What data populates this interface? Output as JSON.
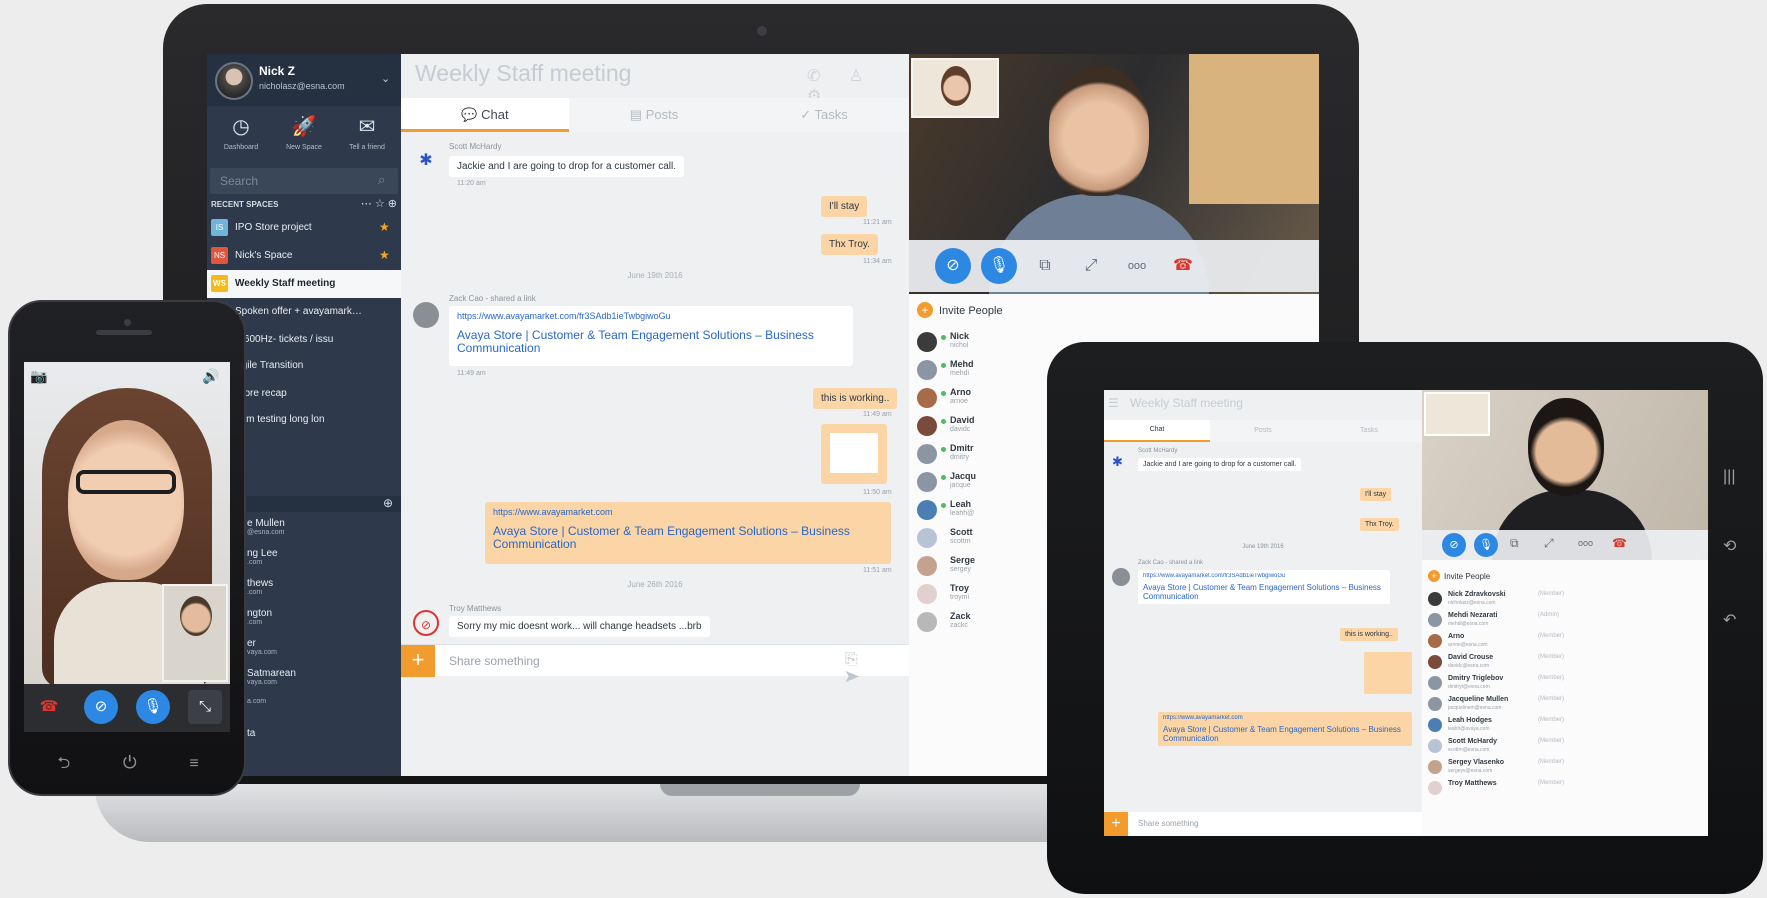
{
  "laptop": {
    "user": {
      "name": "Nick Z",
      "email": "nicholasz@esna.com"
    },
    "quick_actions": [
      {
        "icon": "dashboard-icon",
        "glyph": "◷",
        "label": "Dashboard"
      },
      {
        "icon": "rocket-icon",
        "glyph": "🚀",
        "label": "New Space"
      },
      {
        "icon": "mail-icon",
        "glyph": "✉",
        "label": "Tell a friend"
      }
    ],
    "search": {
      "placeholder": "Search"
    },
    "recent_header": "RECENT SPACES",
    "recent_icons": "⋯ ☆ ⊕",
    "spaces": [
      {
        "badge": "IS",
        "badge_color": "#6fb5d9",
        "name": "IPO Store project",
        "starred": true
      },
      {
        "badge": "NS",
        "badge_color": "#e2553d",
        "name": "Nick's Space",
        "starred": true
      },
      {
        "badge": "WS",
        "badge_color": "#f3b91e",
        "name": "Weekly Staff meeting",
        "starred": false,
        "active": true
      },
      {
        "badge": "SO",
        "badge_color": "#47a6c4",
        "name": "Spoken offer + avayamarket.c",
        "starred": false
      },
      {
        "badge": "",
        "badge_color": "#2e3a4b",
        "name": "-2600Hz- tickets / issu",
        "starred": false
      },
      {
        "badge": "",
        "badge_color": "#2e3a4b",
        "name": "Agile Transition",
        "starred": false
      },
      {
        "badge": "",
        "badge_color": "#2e3a4b",
        "name": "Store recap",
        "starred": false
      },
      {
        "badge": "",
        "badge_color": "#2e3a4b",
        "name": "oom testing long lon",
        "starred": false
      }
    ],
    "people": [
      {
        "name": "e Mullen",
        "sub": "@esna.com"
      },
      {
        "name": "ng Lee",
        "sub": ".com"
      },
      {
        "name": "thews",
        "sub": ".com"
      },
      {
        "name": "ngton",
        "sub": ".com"
      },
      {
        "name": "er",
        "sub": "vaya.com"
      },
      {
        "name": "Satmarean",
        "sub": "vaya.com"
      },
      {
        "name": "",
        "sub": "a.com"
      },
      {
        "name": "ta",
        "sub": ""
      }
    ],
    "chat": {
      "title": "Weekly Staff meeting",
      "header_icons": "✆ ♙ ⚙",
      "tabs": [
        {
          "icon": "chat-icon",
          "glyph": "💬",
          "label": "Chat",
          "active": true
        },
        {
          "icon": "posts-icon",
          "glyph": "▤",
          "label": "Posts",
          "active": false
        },
        {
          "icon": "tasks-icon",
          "glyph": "✓",
          "label": "Tasks",
          "active": false
        }
      ],
      "msg1": {
        "sender": "Scott McHardy",
        "text": "Jackie and I are going to drop for a customer call.",
        "time": "11:20 am"
      },
      "out1": {
        "text": "I'll stay",
        "time": "11:21 am"
      },
      "out2": {
        "text": "Thx Troy.",
        "time": "11:34 am"
      },
      "date1": "June 19th 2016",
      "msg2": {
        "sender": "Zack Cao - shared a link",
        "url": "https://www.avayamarket.com/fr3SAdb1ieTwbgiwoGu",
        "link_title": "Avaya Store | Customer & Team Engagement Solutions – Business Communication",
        "time": "11:49 am"
      },
      "out3": {
        "text": "this is working..",
        "time": "11:49 am"
      },
      "out4_time": "11:50 am",
      "out5": {
        "url": "https://www.avayamarket.com",
        "link_title": "Avaya Store | Customer & Team Engagement Solutions – Business Communication",
        "time": "11:51 am"
      },
      "date2": "June 26th 2016",
      "msg3": {
        "sender": "Troy Matthews",
        "text": "Sorry my mic doesnt work... will change headsets ...brb"
      },
      "compose_placeholder": "Share something",
      "compose_icons": "⎘ ➤"
    },
    "invite_label": "Invite People",
    "participants": [
      {
        "name": "Nick",
        "sub": "nichol"
      },
      {
        "name": "Mehd",
        "sub": "mehdi"
      },
      {
        "name": "Arno",
        "sub": "arnoe"
      },
      {
        "name": "David",
        "sub": "davidc"
      },
      {
        "name": "Dmitr",
        "sub": "dmitry"
      },
      {
        "name": "Jacqu",
        "sub": "jacque"
      },
      {
        "name": "Leah",
        "sub": "leahh@"
      },
      {
        "name": "Scott",
        "sub": "scottm"
      },
      {
        "name": "Serge",
        "sub": "sergey"
      },
      {
        "name": "Troy",
        "sub": "troymi"
      },
      {
        "name": "Zack",
        "sub": "zackc"
      }
    ],
    "call_controls": [
      {
        "name": "video-off-button",
        "glyph": "⊘",
        "style": "blue"
      },
      {
        "name": "mute-button",
        "glyph": "🎙",
        "style": "blue"
      },
      {
        "name": "screen-share-button",
        "glyph": "⧉",
        "style": "plain"
      },
      {
        "name": "expand-button",
        "glyph": "⤢",
        "style": "plain"
      },
      {
        "name": "more-button",
        "glyph": "ooo",
        "style": "plain"
      },
      {
        "name": "hangup-button",
        "glyph": "☎",
        "style": "red"
      }
    ]
  },
  "phone": {
    "top_left_icon": "📷",
    "top_right_icon": "🔊",
    "controls": [
      {
        "name": "phone-hangup-button",
        "glyph": "☎",
        "bg": "#2b2d31",
        "color": "#e0352b"
      },
      {
        "name": "phone-video-button",
        "glyph": "⊘",
        "bg": "#2c88e3",
        "color": "#ffffff"
      },
      {
        "name": "phone-mute-button",
        "glyph": "🎙",
        "bg": "#2c88e3",
        "color": "#ffffff"
      },
      {
        "name": "phone-minimize-button",
        "glyph": "⤡",
        "bg": "#3c3f45",
        "color": "#ffffff"
      }
    ],
    "keys": "⮌ ⏻ ≡"
  },
  "tablet": {
    "title": "Weekly Staff meeting",
    "tabs": [
      "Chat",
      "Posts",
      "Tasks"
    ],
    "msg1": {
      "sender": "Scott McHardy",
      "text": "Jackie and I are going to drop for a customer call."
    },
    "out1": "I'll stay",
    "out2": "Thx Troy.",
    "date1": "June 19th 2016",
    "msg2": {
      "sender": "Zack Cao - shared a link",
      "url": "https://www.avayamarket.com/fr3SAdb1ieTwbgiwoGu",
      "link_title": "Avaya Store | Customer & Team Engagement Solutions – Business Communication"
    },
    "out3": "this is working..",
    "out5": {
      "url": "https://www.avayamarket.com",
      "link_title": "Avaya Store | Customer & Team Engagement Solutions – Business Communication"
    },
    "compose_placeholder": "Share something",
    "invite_label": "Invite People",
    "participants": [
      {
        "name": "Nick Zdravkovski",
        "role": "(Member)",
        "sub": "nicholasz@esna.com"
      },
      {
        "name": "Mehdi Nezarati",
        "role": "(Admin)",
        "sub": "mehdi@esna.com"
      },
      {
        "name": "Arno",
        "role": "(Member)",
        "sub": "arnoe@esna.com"
      },
      {
        "name": "David Crouse",
        "role": "(Member)",
        "sub": "davidc@esna.com"
      },
      {
        "name": "Dmitry Triglebov",
        "role": "(Member)",
        "sub": "dmitryt@esna.com"
      },
      {
        "name": "Jacqueline Mullen",
        "role": "(Member)",
        "sub": "jacquelinem@esna.com"
      },
      {
        "name": "Leah Hodges",
        "role": "(Member)",
        "sub": "leahh@avaya.com"
      },
      {
        "name": "Scott McHardy",
        "role": "(Member)",
        "sub": "scottm@esna.com"
      },
      {
        "name": "Sergey Vlasenko",
        "role": "(Member)",
        "sub": "sergeyv@esna.com"
      },
      {
        "name": "Troy Matthews",
        "role": "(Member)",
        "sub": ""
      }
    ],
    "side_icons": [
      "|||",
      "⟲",
      "↶"
    ]
  }
}
